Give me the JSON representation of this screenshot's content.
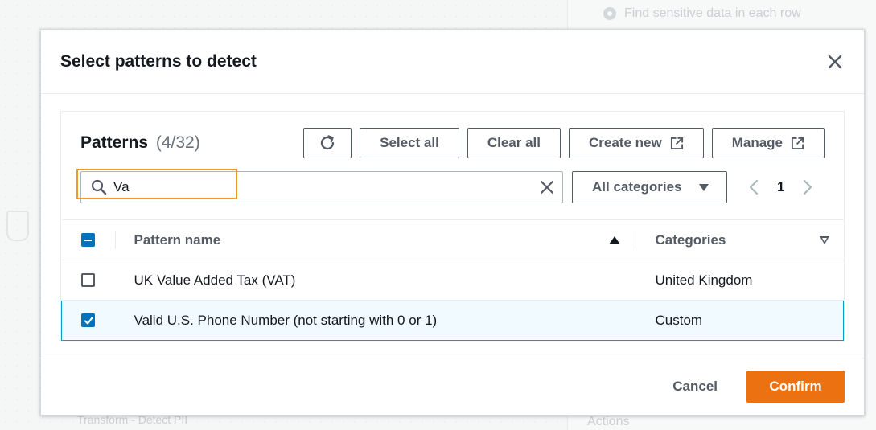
{
  "background": {
    "radio_option": "Find sensitive data in each row",
    "node_label": "Transform - Detect PII",
    "right_section": "Actions"
  },
  "modal": {
    "title": "Select patterns to detect",
    "close_icon": "close-icon"
  },
  "patterns": {
    "heading": "Patterns",
    "count": "(4/32)",
    "refresh_icon": "refresh-icon",
    "select_all": "Select all",
    "clear_all": "Clear all",
    "create_new": "Create new",
    "manage": "Manage",
    "external_icon": "external-link-icon"
  },
  "filter": {
    "search_value": "Va",
    "search_icon": "search-icon",
    "clear_icon": "clear-icon",
    "category_select": "All categories",
    "page": "1"
  },
  "table": {
    "columns": [
      "Pattern name",
      "Categories"
    ],
    "rows": [
      {
        "name": "UK Value Added Tax (VAT)",
        "category": "United Kingdom",
        "checked": false
      },
      {
        "name": "Valid U.S. Phone Number (not starting with 0 or 1)",
        "category": "Custom",
        "checked": true
      }
    ]
  },
  "footer": {
    "cancel": "Cancel",
    "confirm": "Confirm"
  },
  "colors": {
    "primary": "#ec7211",
    "selection": "#0073bb",
    "highlight": "#ec9b26"
  }
}
